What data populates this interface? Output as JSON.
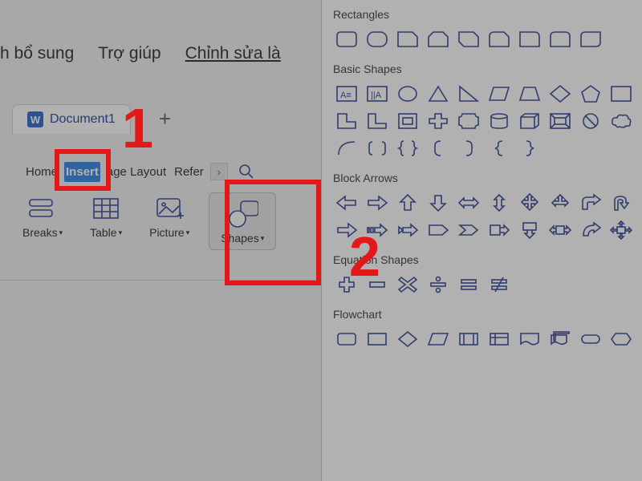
{
  "top_menu": {
    "item1": "h bổ sung",
    "item2": "Trợ giúp",
    "item3": "Chỉnh sửa là"
  },
  "doc": {
    "tab_icon": "W",
    "tab_label": "Document1",
    "plus": "+"
  },
  "ribbon": {
    "home": "Home",
    "insert": "Insert",
    "page_layout": "age Layout",
    "references": "Refer",
    "arrow": "›"
  },
  "groups": {
    "breaks": "Breaks",
    "table": "Table",
    "picture": "Picture",
    "shapes": "Shapes"
  },
  "steps": {
    "one": "1",
    "two": "2"
  },
  "panel": {
    "rectangles": "Rectangles",
    "basic_shapes": "Basic Shapes",
    "block_arrows": "Block Arrows",
    "equation_shapes": "Equation Shapes",
    "flowchart": "Flowchart"
  },
  "colors": {
    "accent": "#2b3e8e",
    "hi": "#e41818",
    "insertBtn": "#2b7de1"
  }
}
